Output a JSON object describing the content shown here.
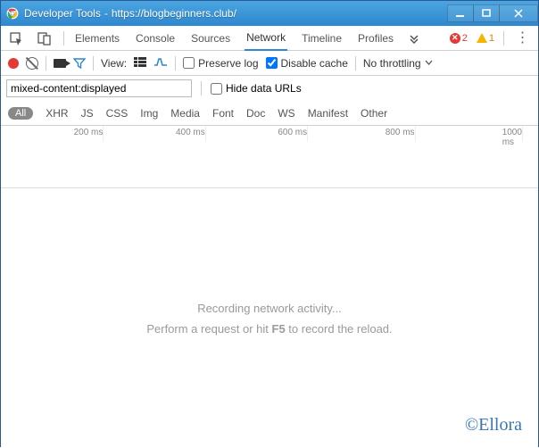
{
  "titlebar": {
    "app": "Developer Tools",
    "sep": "-",
    "url": "https://blogbeginners.club/"
  },
  "tabs": {
    "items": [
      {
        "label": "Elements"
      },
      {
        "label": "Console"
      },
      {
        "label": "Sources"
      },
      {
        "label": "Network"
      },
      {
        "label": "Timeline"
      },
      {
        "label": "Profiles"
      }
    ],
    "active_index": 3,
    "errors": "2",
    "warnings": "1"
  },
  "toolbar": {
    "view_label": "View:",
    "preserve_log": {
      "label": "Preserve log",
      "checked": false
    },
    "disable_cache": {
      "label": "Disable cache",
      "checked": true
    },
    "throttling": "No throttling"
  },
  "filter": {
    "value": "mixed-content:displayed ",
    "hide_urls": {
      "label": "Hide data URLs",
      "checked": false
    }
  },
  "types": {
    "all": "All",
    "items": [
      "XHR",
      "JS",
      "CSS",
      "Img",
      "Media",
      "Font",
      "Doc",
      "WS",
      "Manifest",
      "Other"
    ]
  },
  "timeline": {
    "ticks": [
      {
        "label": "200 ms",
        "pct": 19
      },
      {
        "label": "400 ms",
        "pct": 38
      },
      {
        "label": "600 ms",
        "pct": 57
      },
      {
        "label": "800 ms",
        "pct": 77
      },
      {
        "label": "1000 ms",
        "pct": 97
      }
    ]
  },
  "empty": {
    "line1": "Recording network activity...",
    "line2_a": "Perform a request or hit ",
    "line2_key": "F5",
    "line2_b": " to record the reload."
  },
  "watermark": "©Ellora"
}
